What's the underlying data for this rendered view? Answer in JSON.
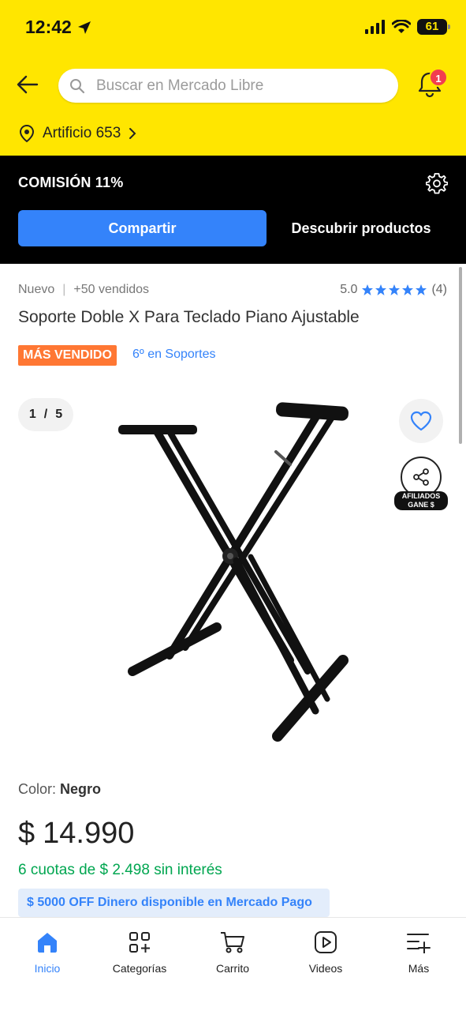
{
  "status_bar": {
    "time": "12:42",
    "battery": "61"
  },
  "header": {
    "search_placeholder": "Buscar en Mercado Libre",
    "notification_count": "1",
    "location": "Artificio 653"
  },
  "affiliate_bar": {
    "commission": "COMISIÓN 11%",
    "share_label": "Compartir",
    "discover_label": "Descubrir productos"
  },
  "product": {
    "condition": "Nuevo",
    "separator": "|",
    "sold": "+50 vendidos",
    "rating": "5.0",
    "rating_value": 5,
    "reviews": "(4)",
    "title": "Soporte Doble X Para Teclado Piano Ajustable",
    "badge": "MÁS VENDIDO",
    "ranking": "6º en Soportes",
    "gallery_current": "1",
    "gallery_sep": "/",
    "gallery_total": "5",
    "affiliate_label_line1": "AFILIADOS",
    "affiliate_label_line2": "GANE $",
    "color_label": "Color:",
    "color_value": "Negro",
    "price_currency": "$",
    "price_amount": "14.990",
    "installments": "6 cuotas de $ 2.498 sin interés",
    "promo": "$ 5000 OFF Dinero disponible en Mercado Pago"
  },
  "bottom_nav": [
    {
      "label": "Inicio",
      "icon": "home-icon"
    },
    {
      "label": "Categorías",
      "icon": "categories-icon"
    },
    {
      "label": "Carrito",
      "icon": "cart-icon"
    },
    {
      "label": "Videos",
      "icon": "video-icon"
    },
    {
      "label": "Más",
      "icon": "more-icon"
    }
  ],
  "colors": {
    "brand_yellow": "#ffe600",
    "accent_blue": "#3483fa",
    "badge_orange": "#ff7733",
    "green": "#00a650",
    "notification_red": "#f23d4f"
  }
}
